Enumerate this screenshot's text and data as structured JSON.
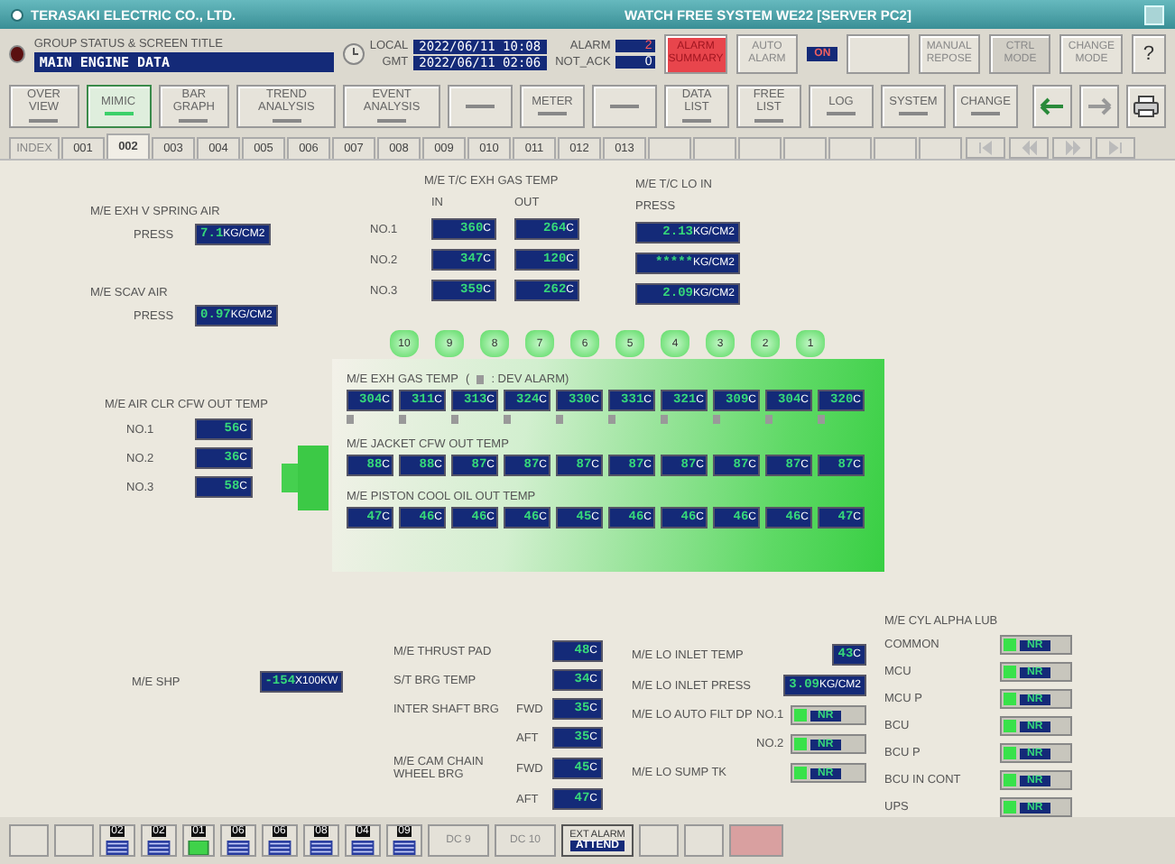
{
  "title_bar": {
    "company": "TERASAKI ELECTRIC CO., LTD.",
    "title": "WATCH FREE SYSTEM WE22 [SERVER PC2]"
  },
  "header": {
    "group_label": "GROUP STATUS & SCREEN TITLE",
    "screen_title": "MAIN ENGINE DATA",
    "local_label": "LOCAL",
    "local_time": "2022/06/11 10:08",
    "gmt_label": "GMT",
    "gmt_time": "2022/06/11 02:06",
    "alarm_label": "ALARM",
    "alarm_count": "2",
    "not_ack_label": "NOT_ACK",
    "not_ack_count": "0",
    "buttons": [
      {
        "kind": "alarm",
        "label": "ALARM SUMMARY",
        "disabled": false
      },
      {
        "kind": "normal",
        "label": "AUTO ALARM",
        "disabled": false
      },
      {
        "kind": "indicator",
        "label": "ON",
        "disabled": false
      },
      {
        "kind": "blank",
        "disabled": false
      },
      {
        "kind": "normal",
        "label": "MANUAL REPOSE",
        "disabled": false
      },
      {
        "kind": "normal",
        "label": "CTRL MODE",
        "disabled": true
      },
      {
        "kind": "normal",
        "label": "CHANGE MODE",
        "disabled": false
      },
      {
        "kind": "help",
        "label": "?",
        "disabled": false
      }
    ]
  },
  "nav_buttons": [
    {
      "kind": "text",
      "label": "OVER VIEW",
      "selected": false
    },
    {
      "kind": "text",
      "label": "MIMIC",
      "selected": true
    },
    {
      "kind": "text",
      "label": "BAR GRAPH",
      "selected": false
    },
    {
      "kind": "text",
      "label": "TREND ANALYSIS",
      "selected": false
    },
    {
      "kind": "text",
      "label": "EVENT ANALYSIS",
      "selected": false
    },
    {
      "kind": "blank",
      "selected": false
    },
    {
      "kind": "text",
      "label": "METER",
      "selected": false
    },
    {
      "kind": "blank",
      "selected": false
    },
    {
      "kind": "text",
      "label": "DATA LIST",
      "selected": false
    },
    {
      "kind": "text",
      "label": "FREE LIST",
      "selected": false
    },
    {
      "kind": "text",
      "label": "LOG",
      "selected": false
    },
    {
      "kind": "text",
      "label": "SYSTEM",
      "selected": false
    },
    {
      "kind": "text",
      "label": "CHANGE",
      "selected": false
    },
    {
      "kind": "back",
      "selected": false
    },
    {
      "kind": "forward",
      "selected": false
    },
    {
      "kind": "print",
      "selected": false
    }
  ],
  "tabs": [
    {
      "label": "INDEX",
      "selected": false
    },
    {
      "label": "001",
      "selected": false
    },
    {
      "label": "002",
      "selected": true
    },
    {
      "label": "003",
      "selected": false
    },
    {
      "label": "004",
      "selected": false
    },
    {
      "label": "005",
      "selected": false
    },
    {
      "label": "006",
      "selected": false
    },
    {
      "label": "007",
      "selected": false
    },
    {
      "label": "008",
      "selected": false
    },
    {
      "label": "009",
      "selected": false
    },
    {
      "label": "010",
      "selected": false
    },
    {
      "label": "011",
      "selected": false
    },
    {
      "label": "012",
      "selected": false
    },
    {
      "label": "013",
      "selected": false
    }
  ],
  "spring_air": {
    "title": "M/E EXH V SPRING AIR",
    "label": "PRESS",
    "value": "7.1KG/CM2"
  },
  "scav_air": {
    "title": "M/E SCAV AIR",
    "label": "PRESS",
    "value": "0.97KG/CM2"
  },
  "tc_exh_gas": {
    "title": "M/E T/C EXH GAS TEMP",
    "columns": [
      "IN",
      "OUT"
    ],
    "rows": [
      {
        "label": "NO.1",
        "in": "360C",
        "out": "264C"
      },
      {
        "label": "NO.2",
        "in": "347C",
        "out": "120C"
      },
      {
        "label": "NO.3",
        "in": "359C",
        "out": "262C"
      }
    ]
  },
  "tc_lo_in": {
    "title": "M/E T/C LO IN",
    "label": "PRESS",
    "values": [
      "2.13KG/CM2",
      "*****KG/CM2",
      "2.09KG/CM2"
    ]
  },
  "cylinders": [
    "10",
    "9",
    "8",
    "7",
    "6",
    "5",
    "4",
    "3",
    "2",
    "1"
  ],
  "exh_gas": {
    "title": "M/E EXH GAS TEMP",
    "legend_open": "(",
    "legend_text": ": DEV ALARM)",
    "cells": [
      {
        "value": "304C",
        "alarm": false
      },
      {
        "value": "311C",
        "alarm": false
      },
      {
        "value": "313C",
        "alarm": false
      },
      {
        "value": "324C",
        "alarm": false
      },
      {
        "value": "330C",
        "alarm": false
      },
      {
        "value": "331C",
        "alarm": false
      },
      {
        "value": "321C",
        "alarm": false
      },
      {
        "value": "309C",
        "alarm": false
      },
      {
        "value": "304C",
        "alarm": false
      },
      {
        "value": "320C",
        "alarm": false
      }
    ]
  },
  "jacket_cfw": {
    "title": "M/E JACKET CFW OUT TEMP",
    "values": [
      "88C",
      "88C",
      "87C",
      "87C",
      "87C",
      "87C",
      "87C",
      "87C",
      "87C",
      "87C"
    ]
  },
  "piston_oil": {
    "title": "M/E PISTON COOL OIL OUT TEMP",
    "values": [
      "47C",
      "46C",
      "46C",
      "46C",
      "45C",
      "46C",
      "46C",
      "46C",
      "46C",
      "47C"
    ]
  },
  "air_cooler": {
    "title": "M/E AIR CLR CFW OUT TEMP",
    "rows": [
      {
        "label": "NO.1",
        "value": "56C"
      },
      {
        "label": "NO.2",
        "value": "36C"
      },
      {
        "label": "NO.3",
        "value": "58C"
      }
    ]
  },
  "shp": {
    "label": "M/E SHP",
    "value": "-154X100KW"
  },
  "bearings": [
    {
      "label": "M/E THRUST PAD",
      "value": "48C"
    },
    {
      "label": "S/T BRG TEMP",
      "value": "34C"
    },
    {
      "label": "INTER SHAFT BRG",
      "sub": "FWD",
      "value": "35C"
    },
    {
      "sub": "AFT",
      "value": "35C"
    },
    {
      "label": "M/E CAM CHAIN WHEEL BRG",
      "sub": "FWD",
      "value": "45C"
    },
    {
      "sub": "AFT",
      "value": "47C"
    }
  ],
  "lube_oil": [
    {
      "kind": "value",
      "label": "M/E LO INLET TEMP",
      "value": "43C"
    },
    {
      "kind": "value",
      "label": "M/E LO INLET PRESS",
      "value": "3.09KG/CM2"
    },
    {
      "kind": "status",
      "label": "M/E LO AUTO FILT DP",
      "sub": "NO.1",
      "status": "NR",
      "on": true
    },
    {
      "kind": "status",
      "sub": "NO.2",
      "status": "NR",
      "on": true
    },
    {
      "kind": "status",
      "label": "M/E LO SUMP TK",
      "status": "NR",
      "on": true
    }
  ],
  "cyl_lub": {
    "title": "M/E CYL ALPHA LUB",
    "rows": [
      {
        "label": "COMMON",
        "status": "NR",
        "on": true
      },
      {
        "label": "MCU",
        "status": "NR",
        "on": true
      },
      {
        "label": "MCU P",
        "status": "NR",
        "on": true
      },
      {
        "label": "BCU",
        "status": "NR",
        "on": true
      },
      {
        "label": "BCU P",
        "status": "NR",
        "on": true
      },
      {
        "label": "BCU IN CONT",
        "status": "NR",
        "on": true
      },
      {
        "label": "UPS",
        "status": "NR",
        "on": true
      }
    ]
  },
  "bottom_bar": [
    {
      "kind": "blank"
    },
    {
      "kind": "blank"
    },
    {
      "kind": "group",
      "label": "02"
    },
    {
      "kind": "group",
      "label": "02"
    },
    {
      "kind": "lamp",
      "label": "01"
    },
    {
      "kind": "group",
      "label": "06"
    },
    {
      "kind": "group",
      "label": "06"
    },
    {
      "kind": "group",
      "label": "08"
    },
    {
      "kind": "group",
      "label": "04"
    },
    {
      "kind": "group",
      "label": "09"
    },
    {
      "kind": "dc",
      "label": "DC 9"
    },
    {
      "kind": "dc",
      "label": "DC 10"
    },
    {
      "kind": "attend",
      "label": "EXT ALARM",
      "sub": "ATTEND"
    },
    {
      "kind": "blank"
    },
    {
      "kind": "blank"
    },
    {
      "kind": "alert"
    }
  ]
}
